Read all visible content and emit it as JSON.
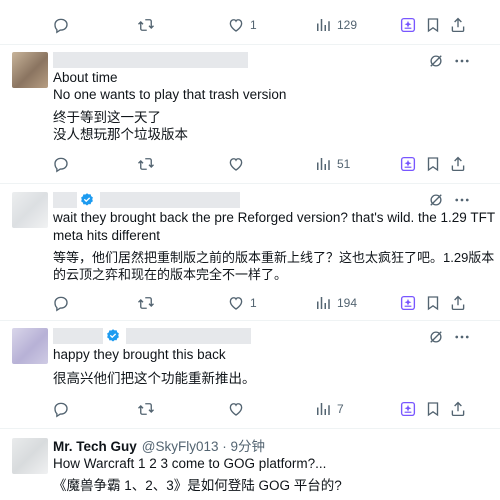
{
  "tweets": [
    {
      "id": "top",
      "stats": {
        "reply": "",
        "retweet": "",
        "like": "1",
        "views": "129"
      }
    },
    {
      "id": "t1",
      "lines": [
        "About time",
        "No one wants to play that trash version"
      ],
      "translation": [
        "终于等到这一天了",
        "没人想玩那个垃圾版本"
      ],
      "stats": {
        "reply": "",
        "retweet": "",
        "like": "",
        "views": "51"
      }
    },
    {
      "id": "t2",
      "lines": [
        "wait they brought back the pre Reforged version? that's wild. the 1.29 TFT",
        "meta hits different"
      ],
      "translation": [
        "等等，他们居然把重制版之前的版本重新上线了？这也太疯狂了吧。1.29版本",
        "的云顶之弈和现在的版本完全不一样了。"
      ],
      "stats": {
        "reply": "",
        "retweet": "",
        "like": "1",
        "views": "194"
      }
    },
    {
      "id": "t3",
      "lines": [
        "happy they brought this back"
      ],
      "translation": [
        "很高兴他们把这个功能重新推出。"
      ],
      "stats": {
        "reply": "",
        "retweet": "",
        "like": "",
        "views": "7"
      }
    },
    {
      "id": "t4",
      "author": "Mr. Tech Guy",
      "handle": "@SkyFly013 · 9分钟",
      "lines": [
        "How Warcraft 1 2 3 come to GOG platform?..."
      ],
      "translation": [
        "《魔兽争霸 1、2、3》是如何登陆 GOG 平台的?"
      ]
    }
  ],
  "colors": {
    "icon": "#536471",
    "verified": "#1d9bf0",
    "grok": "#7856ff",
    "text": "#0f1419",
    "separator": "#eff3f4"
  },
  "icons": [
    "reply-icon",
    "retweet-icon",
    "like-icon",
    "views-icon",
    "grok-icon",
    "bookmark-icon",
    "share-icon",
    "no-edit-icon",
    "more-icon",
    "verified-icon"
  ]
}
